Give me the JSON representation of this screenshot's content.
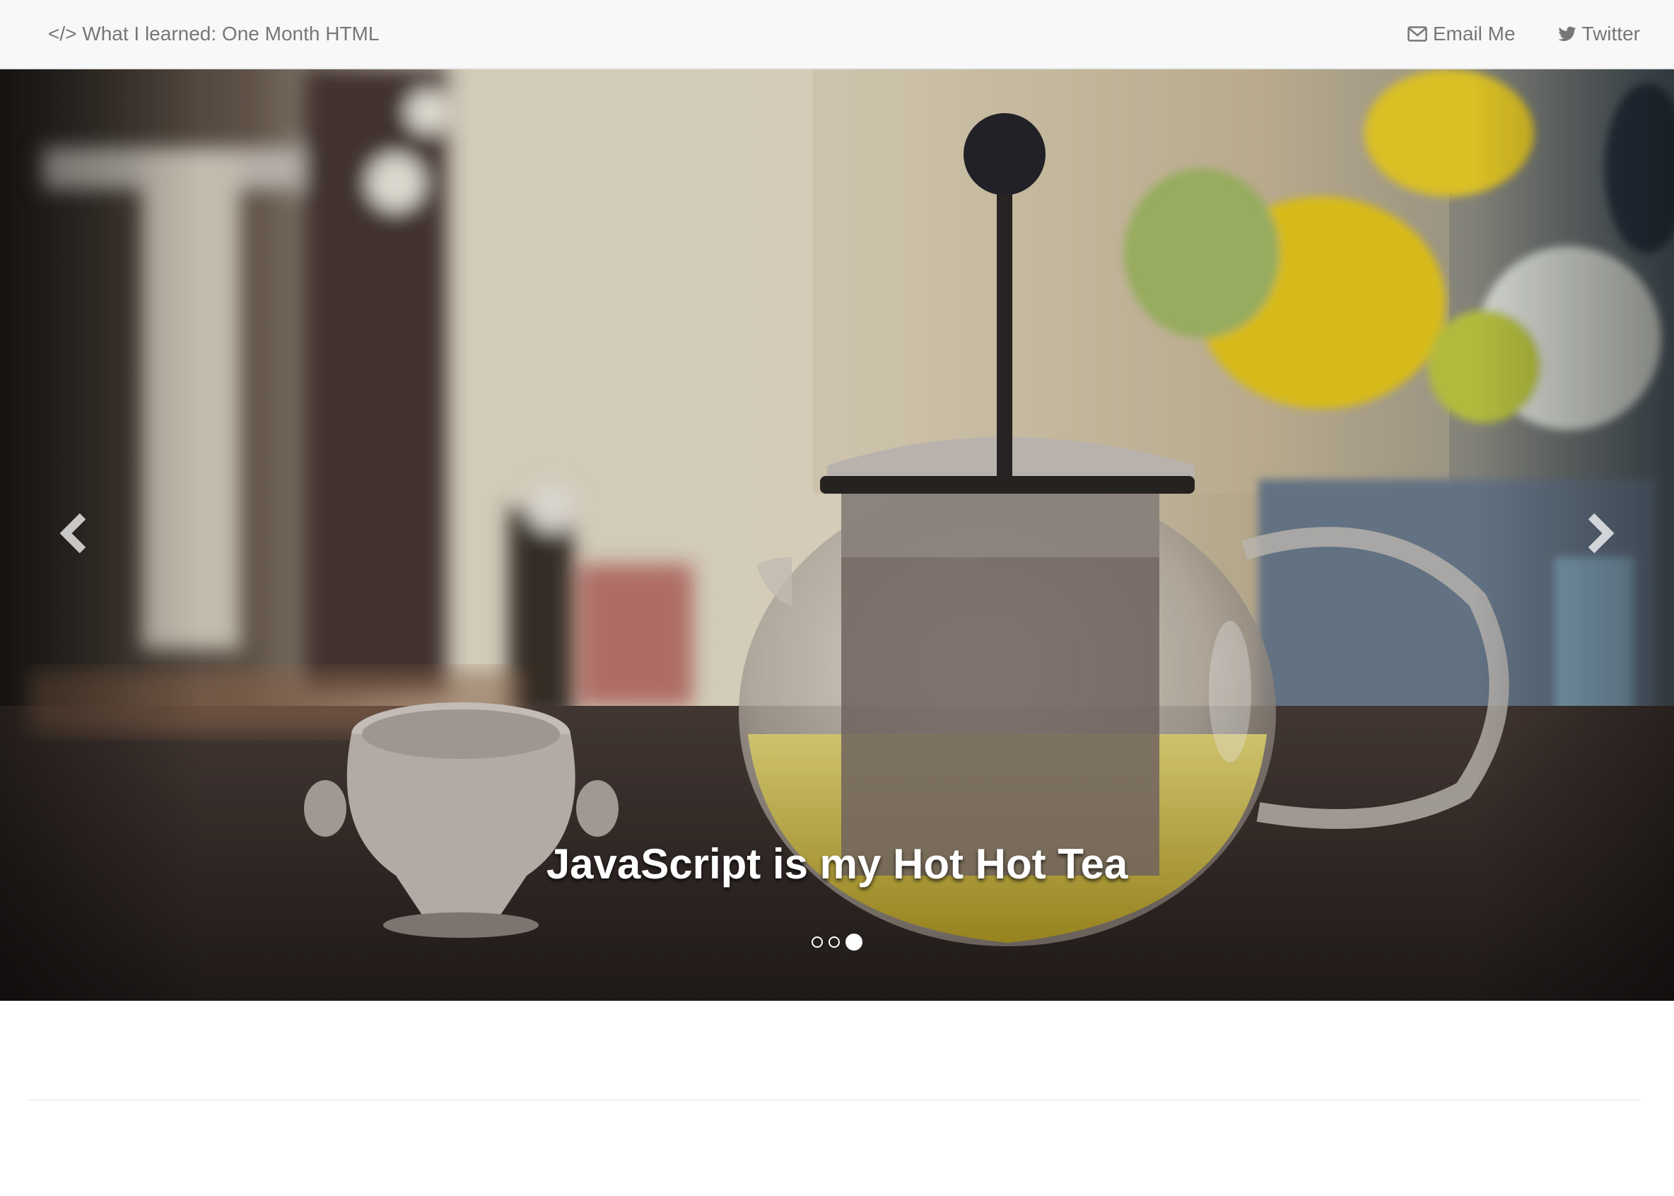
{
  "navbar": {
    "brand": "</> What I learned: One Month HTML",
    "links": [
      {
        "label": "Email Me",
        "icon": "envelope-icon"
      },
      {
        "label": "Twitter",
        "icon": "twitter-icon"
      }
    ]
  },
  "carousel": {
    "caption": "JavaScript is my Hot Hot Tea",
    "slide_count": 3,
    "active_slide": 3,
    "prev_icon": "chevron-left-icon",
    "next_icon": "chevron-right-icon"
  },
  "colors": {
    "navbar_bg": "#f8f8f8",
    "nav_text": "#777777",
    "caption_text": "#ffffff"
  }
}
